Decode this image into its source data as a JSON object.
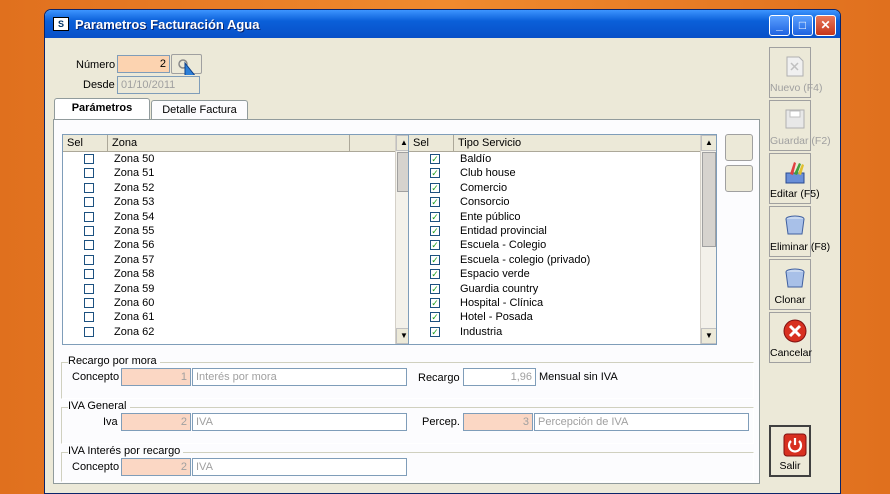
{
  "window": {
    "title": "Parametros Facturación Agua"
  },
  "header": {
    "numero_label": "Número",
    "numero_value": "2",
    "desde_label": "Desde",
    "desde_value": "01/10/2011"
  },
  "tabs": [
    {
      "label": "Parámetros",
      "selected": true
    },
    {
      "label": "Detalle Factura",
      "selected": false
    }
  ],
  "zona_grid": {
    "col_sel": "Sel",
    "col_zona": "Zona",
    "rows": [
      {
        "label": "Zona 50",
        "checked": false
      },
      {
        "label": "Zona 51",
        "checked": false
      },
      {
        "label": "Zona 52",
        "checked": false
      },
      {
        "label": "Zona 53",
        "checked": false
      },
      {
        "label": "Zona 54",
        "checked": false
      },
      {
        "label": "Zona 55",
        "checked": false
      },
      {
        "label": "Zona 56",
        "checked": false
      },
      {
        "label": "Zona 57",
        "checked": false
      },
      {
        "label": "Zona 58",
        "checked": false
      },
      {
        "label": "Zona 59",
        "checked": false
      },
      {
        "label": "Zona 60",
        "checked": false
      },
      {
        "label": "Zona 61",
        "checked": false
      },
      {
        "label": "Zona 62",
        "checked": false
      }
    ]
  },
  "servicio_grid": {
    "col_sel": "Sel",
    "col_tipo": "Tipo Servicio",
    "rows": [
      {
        "label": "Baldío",
        "checked": true
      },
      {
        "label": "Club house",
        "checked": true
      },
      {
        "label": "Comercio",
        "checked": true
      },
      {
        "label": "Consorcio",
        "checked": true
      },
      {
        "label": "Ente público",
        "checked": true
      },
      {
        "label": "Entidad provincial",
        "checked": true
      },
      {
        "label": "Escuela - Colegio",
        "checked": true
      },
      {
        "label": "Escuela - colegio (privado)",
        "checked": true
      },
      {
        "label": "Espacio verde",
        "checked": true
      },
      {
        "label": "Guardia country",
        "checked": true
      },
      {
        "label": "Hospital - Clínica",
        "checked": true
      },
      {
        "label": "Hotel - Posada",
        "checked": true
      },
      {
        "label": "Industria",
        "checked": true
      }
    ]
  },
  "recargo_mora": {
    "title": "Recargo por mora",
    "concepto_label": "Concepto",
    "concepto_code": "1",
    "concepto_desc": "Interés por mora",
    "recargo_label": "Recargo",
    "recargo_value": "1,96",
    "recargo_suffix": "Mensual sin IVA"
  },
  "iva_general": {
    "title": "IVA General",
    "iva_label": "Iva",
    "iva_code": "2",
    "iva_desc": "IVA",
    "percep_label": "Percep.",
    "percep_code": "3",
    "percep_desc": "Percepción de IVA"
  },
  "iva_recargo": {
    "title": "IVA Interés por recargo",
    "concepto_label": "Concepto",
    "concepto_code": "2",
    "concepto_desc": "IVA"
  },
  "sidebar": {
    "nuevo": "Nuevo (F4)",
    "guardar": "Guardar (F2)",
    "editar": "Editar (F5)",
    "eliminar": "Eliminar (F8)",
    "clonar": "Clonar",
    "cancelar": "Cancelar",
    "salir": "Salir"
  },
  "colors": {
    "titlebar": "#0a5fd8",
    "window_bg": "#ece9d8",
    "pk_field": "#fbd7c4",
    "desktop": "#f08a2e"
  }
}
